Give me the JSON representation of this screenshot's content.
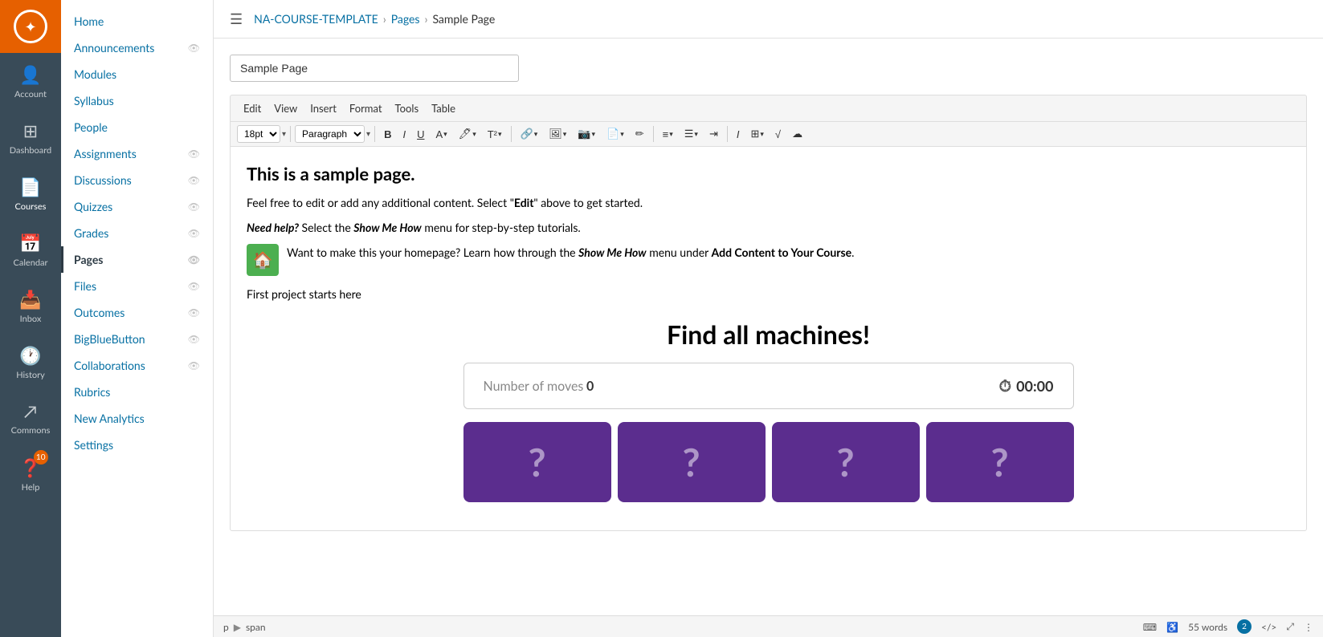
{
  "globalNav": {
    "logo": "✦",
    "items": [
      {
        "id": "account",
        "label": "Account",
        "icon": "👤"
      },
      {
        "id": "dashboard",
        "label": "Dashboard",
        "icon": "⊞"
      },
      {
        "id": "courses",
        "label": "Courses",
        "icon": "📄",
        "active": true
      },
      {
        "id": "calendar",
        "label": "Calendar",
        "icon": "📅"
      },
      {
        "id": "inbox",
        "label": "Inbox",
        "icon": "📥"
      },
      {
        "id": "history",
        "label": "History",
        "icon": "🕐"
      },
      {
        "id": "commons",
        "label": "Commons",
        "icon": "↗"
      },
      {
        "id": "help",
        "label": "Help",
        "icon": "❓",
        "badge": "10"
      }
    ]
  },
  "breadcrumb": {
    "menu_icon": "☰",
    "course": "NA-COURSE-TEMPLATE",
    "section": "Pages",
    "current": "Sample Page"
  },
  "courseNav": {
    "items": [
      {
        "id": "home",
        "label": "Home",
        "eyeIcon": false
      },
      {
        "id": "announcements",
        "label": "Announcements",
        "eyeIcon": true
      },
      {
        "id": "modules",
        "label": "Modules",
        "eyeIcon": false
      },
      {
        "id": "syllabus",
        "label": "Syllabus",
        "eyeIcon": false
      },
      {
        "id": "people",
        "label": "People",
        "eyeIcon": false
      },
      {
        "id": "assignments",
        "label": "Assignments",
        "eyeIcon": true
      },
      {
        "id": "discussions",
        "label": "Discussions",
        "eyeIcon": true
      },
      {
        "id": "quizzes",
        "label": "Quizzes",
        "eyeIcon": true
      },
      {
        "id": "grades",
        "label": "Grades",
        "eyeIcon": true
      },
      {
        "id": "pages",
        "label": "Pages",
        "eyeIcon": true,
        "active": true
      },
      {
        "id": "files",
        "label": "Files",
        "eyeIcon": true
      },
      {
        "id": "outcomes",
        "label": "Outcomes",
        "eyeIcon": true
      },
      {
        "id": "bigbluebutton",
        "label": "BigBlueButton",
        "eyeIcon": true
      },
      {
        "id": "collaborations",
        "label": "Collaborations",
        "eyeIcon": true
      },
      {
        "id": "rubrics",
        "label": "Rubrics",
        "eyeIcon": false
      },
      {
        "id": "newanalytics",
        "label": "New Analytics",
        "eyeIcon": false
      },
      {
        "id": "settings",
        "label": "Settings",
        "eyeIcon": false
      }
    ]
  },
  "toolbar": {
    "menuItems": [
      "Edit",
      "View",
      "Insert",
      "Format",
      "Tools",
      "Table"
    ],
    "fontSizeLabel": "18pt",
    "paragraphLabel": "Paragraph",
    "boldLabel": "B",
    "italicLabel": "I",
    "underlineLabel": "U"
  },
  "page": {
    "titleValue": "Sample Page",
    "titlePlaceholder": "Sample Page",
    "heading": "This is a sample page.",
    "para1_pre": "Feel free to edit or add any additional content.  Select \"",
    "para1_bold": "Edit",
    "para1_post": "\" above to get started.",
    "para2_pre": "Need help?",
    "para2_italic": " Select the ",
    "para2_bolditalic": "Show Me How",
    "para2_post": " menu for step-by-step tutorials.",
    "para3_pre": " Want to make this your homepage? Learn how through the ",
    "para3_bolditalic": "Show Me How",
    "para3_mid": " menu under ",
    "para3_bold": "Add Content to Your Course",
    "para3_post": ".",
    "para4": "First project starts here",
    "gameTitle": "Find all machines!",
    "movesLabel": "Number of moves",
    "movesCount": "0",
    "timerValue": "00:00",
    "cardSymbol": "?"
  },
  "statusbar": {
    "pathP": "p",
    "pathArrow": "▶",
    "pathSpan": "span",
    "wordCount": "55 words",
    "badge": "2"
  }
}
